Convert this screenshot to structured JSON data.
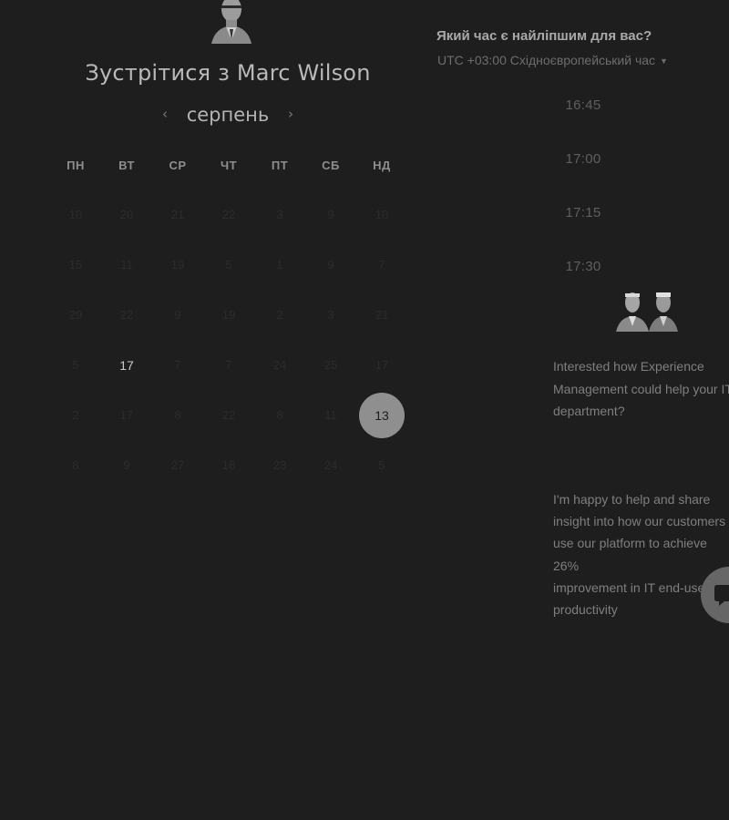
{
  "title": "Зустрітися з Marc Wilson",
  "calendar": {
    "month": "серпень",
    "prev_icon": "chevron-left-icon",
    "next_icon": "chevron-right-icon",
    "weekdays": [
      "ПН",
      "ВТ",
      "СР",
      "ЧТ",
      "ПТ",
      "СБ",
      "НД"
    ],
    "weeks": [
      [
        "10",
        "20",
        "21",
        "22",
        "3",
        "9",
        "10"
      ],
      [
        "15",
        "11",
        "19",
        "5",
        "1",
        "9",
        "7"
      ],
      [
        "29",
        "22",
        "9",
        "19",
        "2",
        "3",
        "21"
      ],
      [
        "5",
        "17",
        "7",
        "7",
        "24",
        "25",
        "17"
      ],
      [
        "2",
        "17",
        "8",
        "22",
        "8",
        "11",
        "13"
      ],
      [
        "8",
        "9",
        "27",
        "18",
        "23",
        "24",
        "5"
      ]
    ],
    "available_days": [
      "17"
    ],
    "selected_day": "13"
  },
  "scheduler": {
    "heading": "Який час є найліпшим для вас?",
    "timezone": "UTC +03:00 Східноєвропейський час",
    "slots": [
      "16:45",
      "17:00",
      "17:15",
      "17:30"
    ]
  },
  "promo": {
    "paragraph1": "Interested how Experience\nManagement could help your IT\ndepartment?",
    "paragraph2": "I'm happy to help and share\ninsight into how our customers\nuse our platform to achieve 26%\nimprovement in IT end-user\nproductivity"
  },
  "colors": {
    "background": "#1e1e1f",
    "selected": "#8f8f8f"
  }
}
